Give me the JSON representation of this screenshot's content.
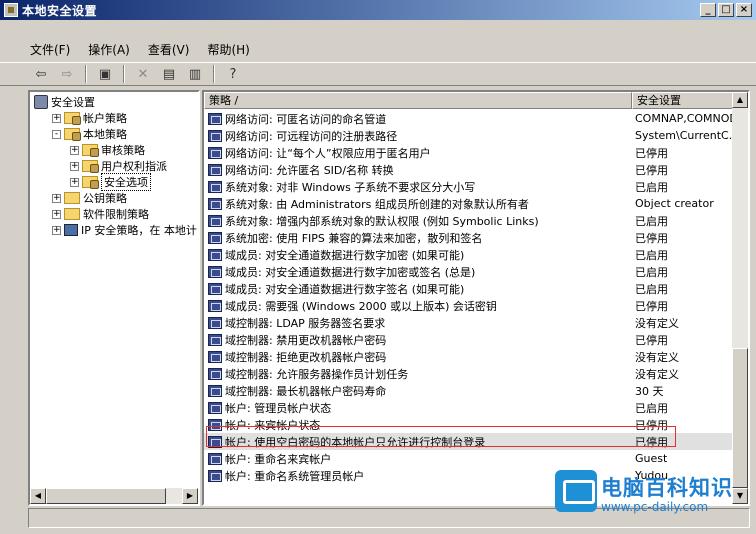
{
  "window": {
    "title": "本地安全设置"
  },
  "titlebar_buttons": [
    "_",
    "□",
    "×"
  ],
  "menu": [
    {
      "label": "文件(F)"
    },
    {
      "label": "操作(A)"
    },
    {
      "label": "查看(V)"
    },
    {
      "label": "帮助(H)"
    }
  ],
  "toolbar": [
    "back-arrow-icon",
    "forward-arrow-icon",
    "up-folder-icon",
    "delete-icon",
    "properties-icon",
    "export-icon",
    "help-icon"
  ],
  "tree": [
    {
      "label": "安全设置",
      "level": 0,
      "expander": "",
      "icon": "security"
    },
    {
      "label": "帐户策略",
      "level": 1,
      "expander": "+",
      "icon": "folder-lock"
    },
    {
      "label": "本地策略",
      "level": 1,
      "expander": "-",
      "icon": "folder-lock"
    },
    {
      "label": "审核策略",
      "level": 2,
      "expander": "+",
      "icon": "folder-lock"
    },
    {
      "label": "用户权利指派",
      "level": 2,
      "expander": "+",
      "icon": "folder-lock"
    },
    {
      "label": "安全选项",
      "level": 2,
      "expander": "+",
      "icon": "folder-lock",
      "selected": true
    },
    {
      "label": "公钥策略",
      "level": 1,
      "expander": "+",
      "icon": "folder"
    },
    {
      "label": "软件限制策略",
      "level": 1,
      "expander": "+",
      "icon": "folder"
    },
    {
      "label": "IP 安全策略，在 本地计",
      "level": 1,
      "expander": "+",
      "icon": "computer"
    }
  ],
  "columns": {
    "policy": "策略 /",
    "setting": "安全设置"
  },
  "policies": [
    {
      "name": "网络访问: 可匿名访问的命名管道",
      "setting": "COMNAP,COMNODE,..."
    },
    {
      "name": "网络访问: 可远程访问的注册表路径",
      "setting": "System\\CurrentC..."
    },
    {
      "name": "网络访问: 让“每个人”权限应用于匿名用户",
      "setting": "已停用"
    },
    {
      "name": "网络访问: 允许匿名 SID/名称 转换",
      "setting": "已停用"
    },
    {
      "name": "系统对象: 对非 Windows 子系统不要求区分大小写",
      "setting": "已启用"
    },
    {
      "name": "系统对象: 由 Administrators 组成员所创建的对象默认所有者",
      "setting": "Object creator"
    },
    {
      "name": "系统对象: 增强内部系统对象的默认权限 (例如 Symbolic Links)",
      "setting": "已启用"
    },
    {
      "name": "系统加密: 使用 FIPS 兼容的算法来加密，散列和签名",
      "setting": "已停用"
    },
    {
      "name": "域成员: 对安全通道数据进行数字加密 (如果可能)",
      "setting": "已启用"
    },
    {
      "name": "域成员: 对安全通道数据进行数字加密或签名 (总是)",
      "setting": "已启用"
    },
    {
      "name": "域成员: 对安全通道数据进行数字签名 (如果可能)",
      "setting": "已启用"
    },
    {
      "name": "域成员: 需要强 (Windows 2000 或以上版本) 会话密钥",
      "setting": "已停用"
    },
    {
      "name": "域控制器: LDAP 服务器签名要求",
      "setting": "没有定义"
    },
    {
      "name": "域控制器: 禁用更改机器帐户密码",
      "setting": "已停用"
    },
    {
      "name": "域控制器: 拒绝更改机器帐户密码",
      "setting": "没有定义"
    },
    {
      "name": "域控制器: 允许服务器操作员计划任务",
      "setting": "没有定义"
    },
    {
      "name": "域控制器: 最长机器帐户密码寿命",
      "setting": "30 天"
    },
    {
      "name": "帐户: 管理员帐户状态",
      "setting": "已启用"
    },
    {
      "name": "帐户: 来宾帐户状态",
      "setting": "已停用"
    },
    {
      "name": "帐户: 使用空白密码的本地帐户只允许进行控制台登录",
      "setting": "已停用",
      "highlight": true
    },
    {
      "name": "帐户: 重命名来宾帐户",
      "setting": "Guest"
    },
    {
      "name": "帐户: 重命名系统管理员帐户",
      "setting": "Yudou"
    }
  ],
  "watermark": {
    "title": "电脑百科知识",
    "url": "www.pc-daily.com"
  },
  "colors": {
    "titlebar_start": "#0a246a",
    "titlebar_end": "#a6caf0",
    "highlight_box": "#e03030",
    "watermark": "#1e7fd0"
  }
}
